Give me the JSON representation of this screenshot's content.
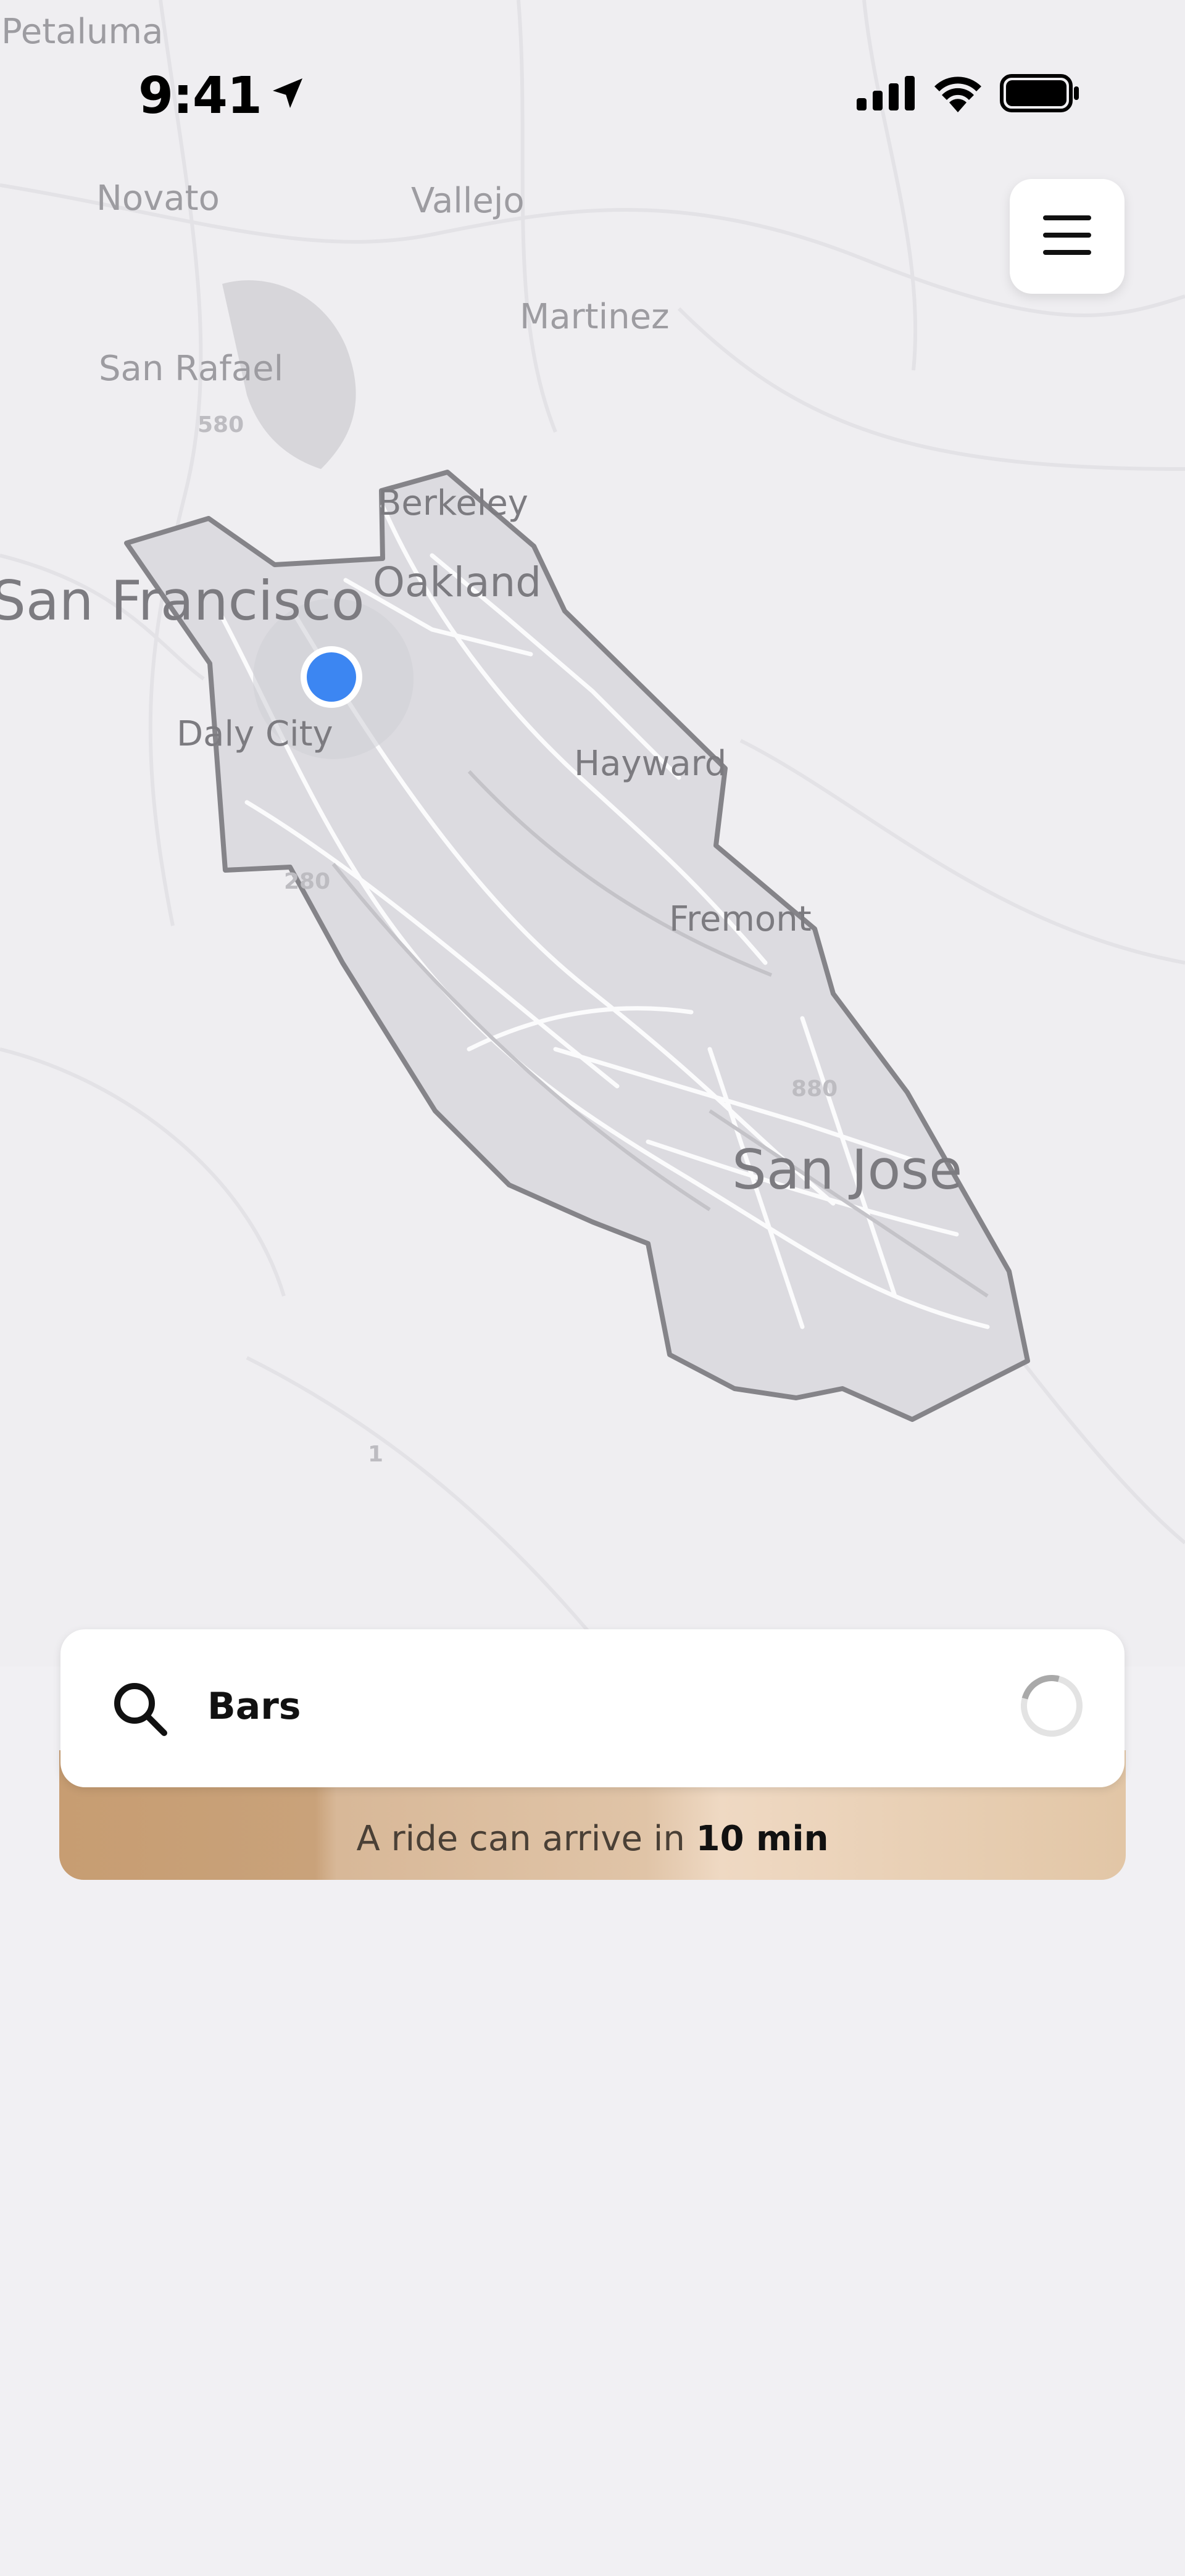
{
  "status_bar": {
    "time": "9:41",
    "location_icon": "location-arrow-icon",
    "signal_icon": "cellular-signal-icon",
    "wifi_icon": "wifi-icon",
    "battery_icon": "battery-icon"
  },
  "menu": {
    "icon": "hamburger-menu-icon"
  },
  "map": {
    "labels": {
      "petaluma": "Petaluma",
      "novato": "Novato",
      "vallejo": "Vallejo",
      "martinez": "Martinez",
      "san_rafael": "San Rafael",
      "berkeley": "Berkeley",
      "oakland": "Oakland",
      "san_francisco": "San Francisco",
      "daly_city": "Daly City",
      "hayward": "Hayward",
      "fremont": "Fremont",
      "san_jose": "San Jose"
    },
    "highways": {
      "h580": "580",
      "h280": "280",
      "h880": "880",
      "h1": "1"
    },
    "colors": {
      "service_area": "#dcdbe0",
      "boundary": "#858489",
      "location_dot": "#3c86f2",
      "water": "#c9c8cc"
    }
  },
  "search": {
    "value": "Bars",
    "icon": "search-icon",
    "loading": true
  },
  "eta": {
    "prefix": "A ride can arrive in ",
    "time": "10 min"
  }
}
